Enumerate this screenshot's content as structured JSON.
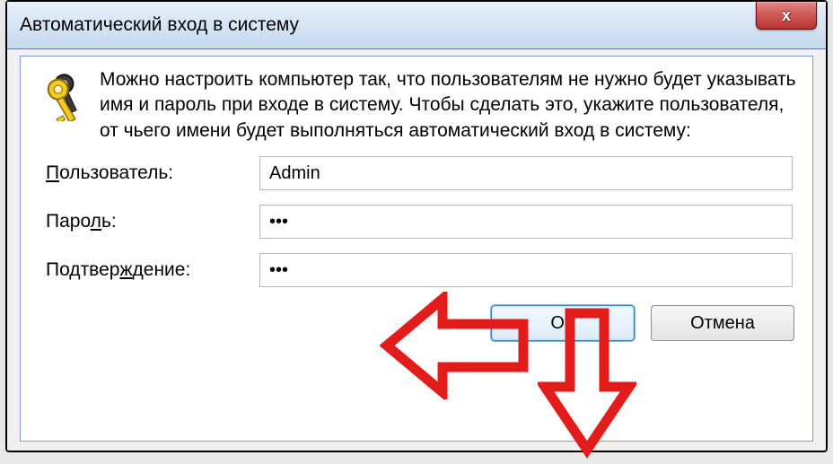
{
  "window": {
    "title": "Автоматический вход в систему",
    "close_label": "x"
  },
  "description": "Можно настроить компьютер так, что пользователям не нужно будет указывать имя и пароль при входе в систему. Чтобы сделать это, укажите пользователя, от чьего имени будет выполняться автоматический вход в систему:",
  "labels": {
    "user_pre": "П",
    "user_post": "ользователь:",
    "password_pre": "Паро",
    "password_u": "л",
    "password_post": "ь:",
    "confirm_pre": "Подтвер",
    "confirm_u": "ж",
    "confirm_post": "дение:"
  },
  "fields": {
    "user_value": "Admin",
    "password_value": "•••",
    "confirm_value": "•••"
  },
  "buttons": {
    "ok": "ОК",
    "cancel": "Отмена"
  },
  "annotations": {
    "left_arrow": "arrow-left-icon",
    "down_arrow": "arrow-down-icon"
  }
}
